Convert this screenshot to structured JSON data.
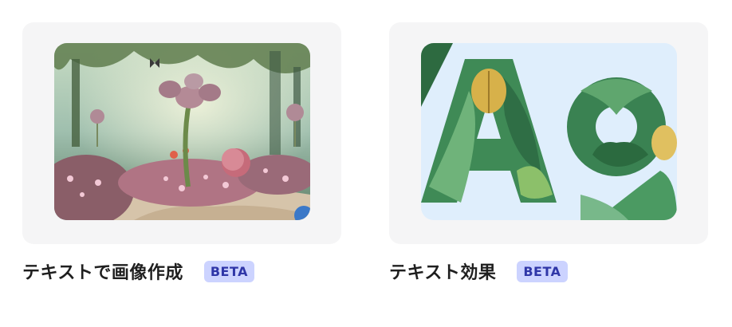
{
  "cards": [
    {
      "title": "テキストで画像作成",
      "badge": "BETA",
      "image": "fantasy-garden-illustration"
    },
    {
      "title": "テキスト効果",
      "badge": "BETA",
      "image": "leaf-letters-illustration"
    }
  ],
  "colors": {
    "badge_bg": "#ccd3ff",
    "badge_text": "#2f36a8",
    "card_bg": "#f5f5f6"
  }
}
